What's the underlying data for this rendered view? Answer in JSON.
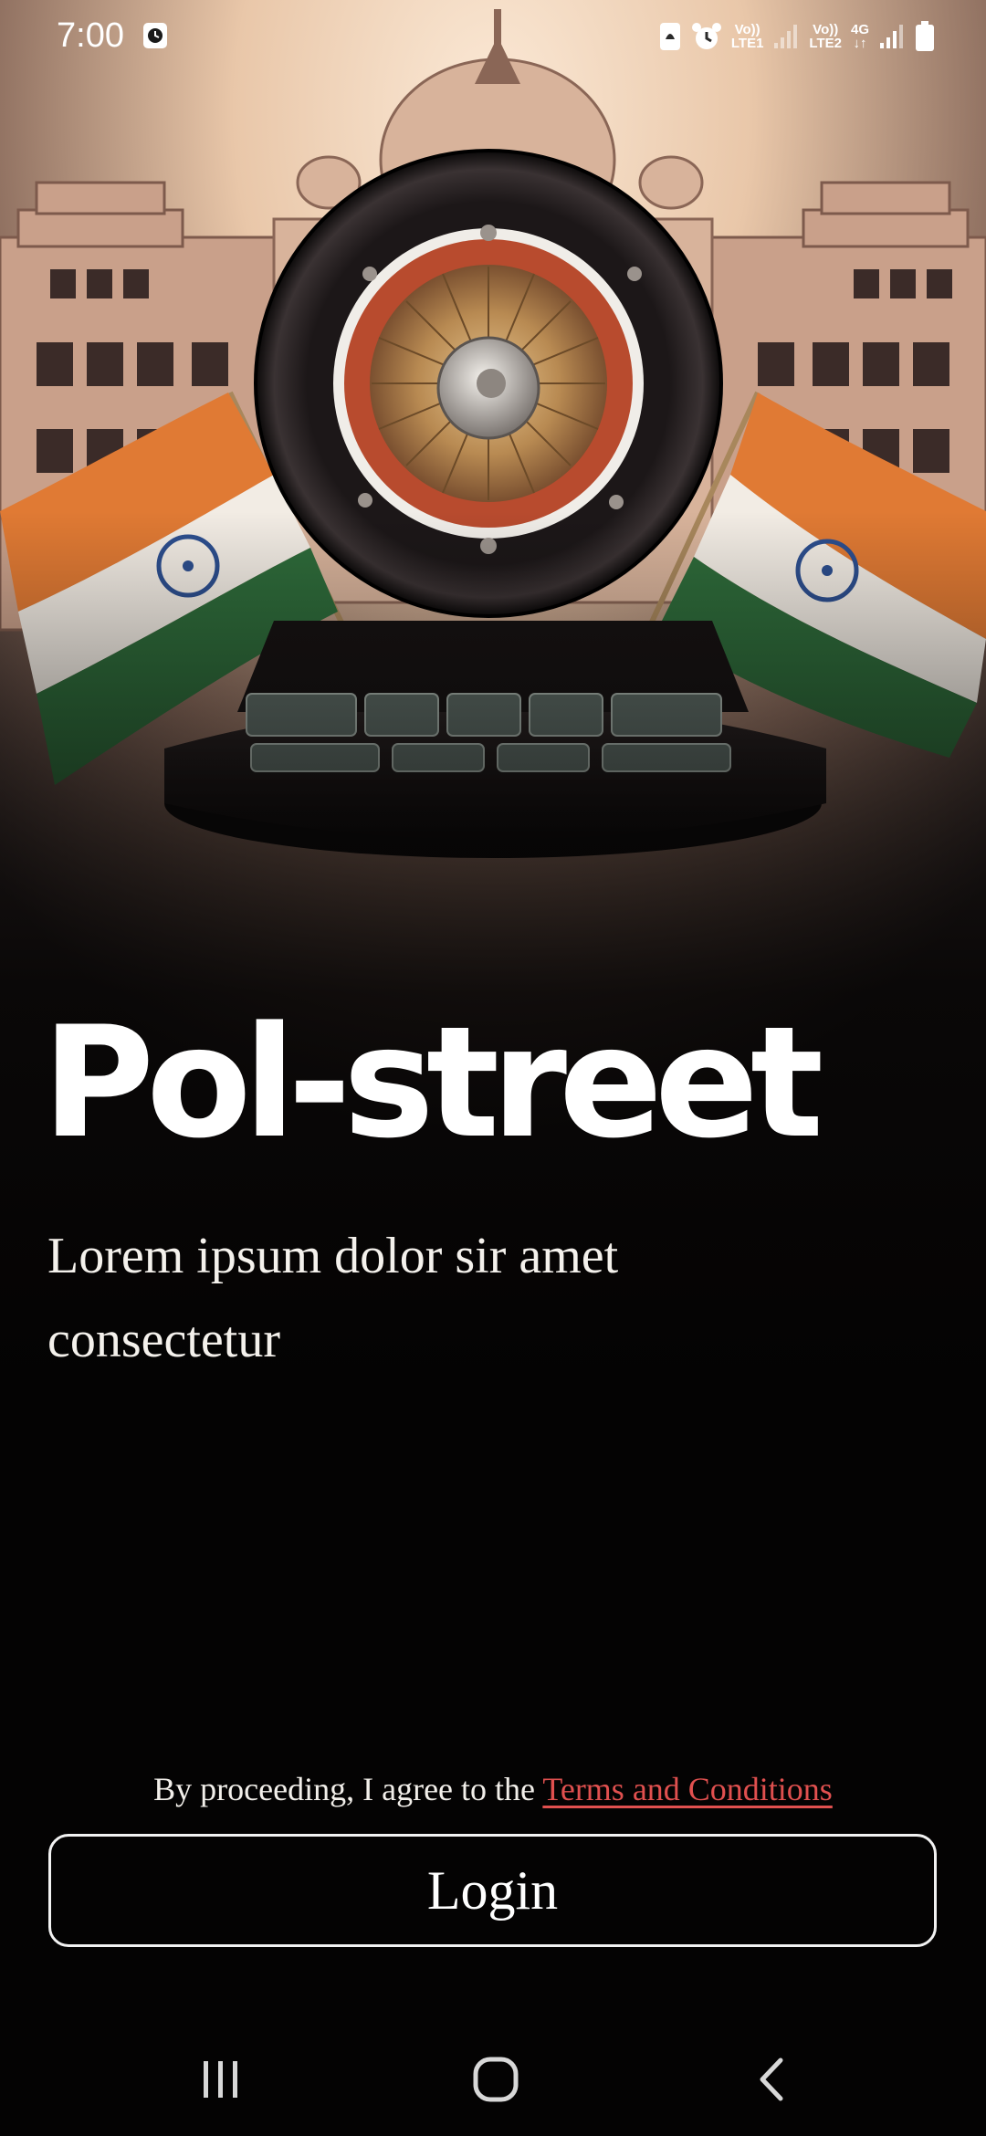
{
  "status_bar": {
    "time": "7:00",
    "icons": [
      "clock-badge-icon",
      "ring-mode-icon",
      "alarm-icon",
      "volte-lte1-icon",
      "signal-1-icon",
      "volte-lte2-icon",
      "network-4g-icon",
      "signal-2-icon",
      "battery-icon"
    ],
    "lte1_top": "Vo))",
    "lte1_bottom": "LTE1",
    "lte2_top": "Vo))",
    "lte2_bottom": "LTE2",
    "net_top": "4G",
    "net_bottom": "↓↑"
  },
  "hero": {
    "image": "roulette-wheel-palace-flags-illustration"
  },
  "app": {
    "title": "Pol-street",
    "subtitle": "Lorem ipsum dolor sir amet consectetur"
  },
  "terms": {
    "prefix": "By proceeding, I agree to the ",
    "link": "Terms and Conditions",
    "link_color": "#e0504f"
  },
  "login": {
    "label": "Login"
  },
  "nav": {
    "buttons": [
      "recent-apps-icon",
      "home-icon",
      "back-icon"
    ]
  }
}
